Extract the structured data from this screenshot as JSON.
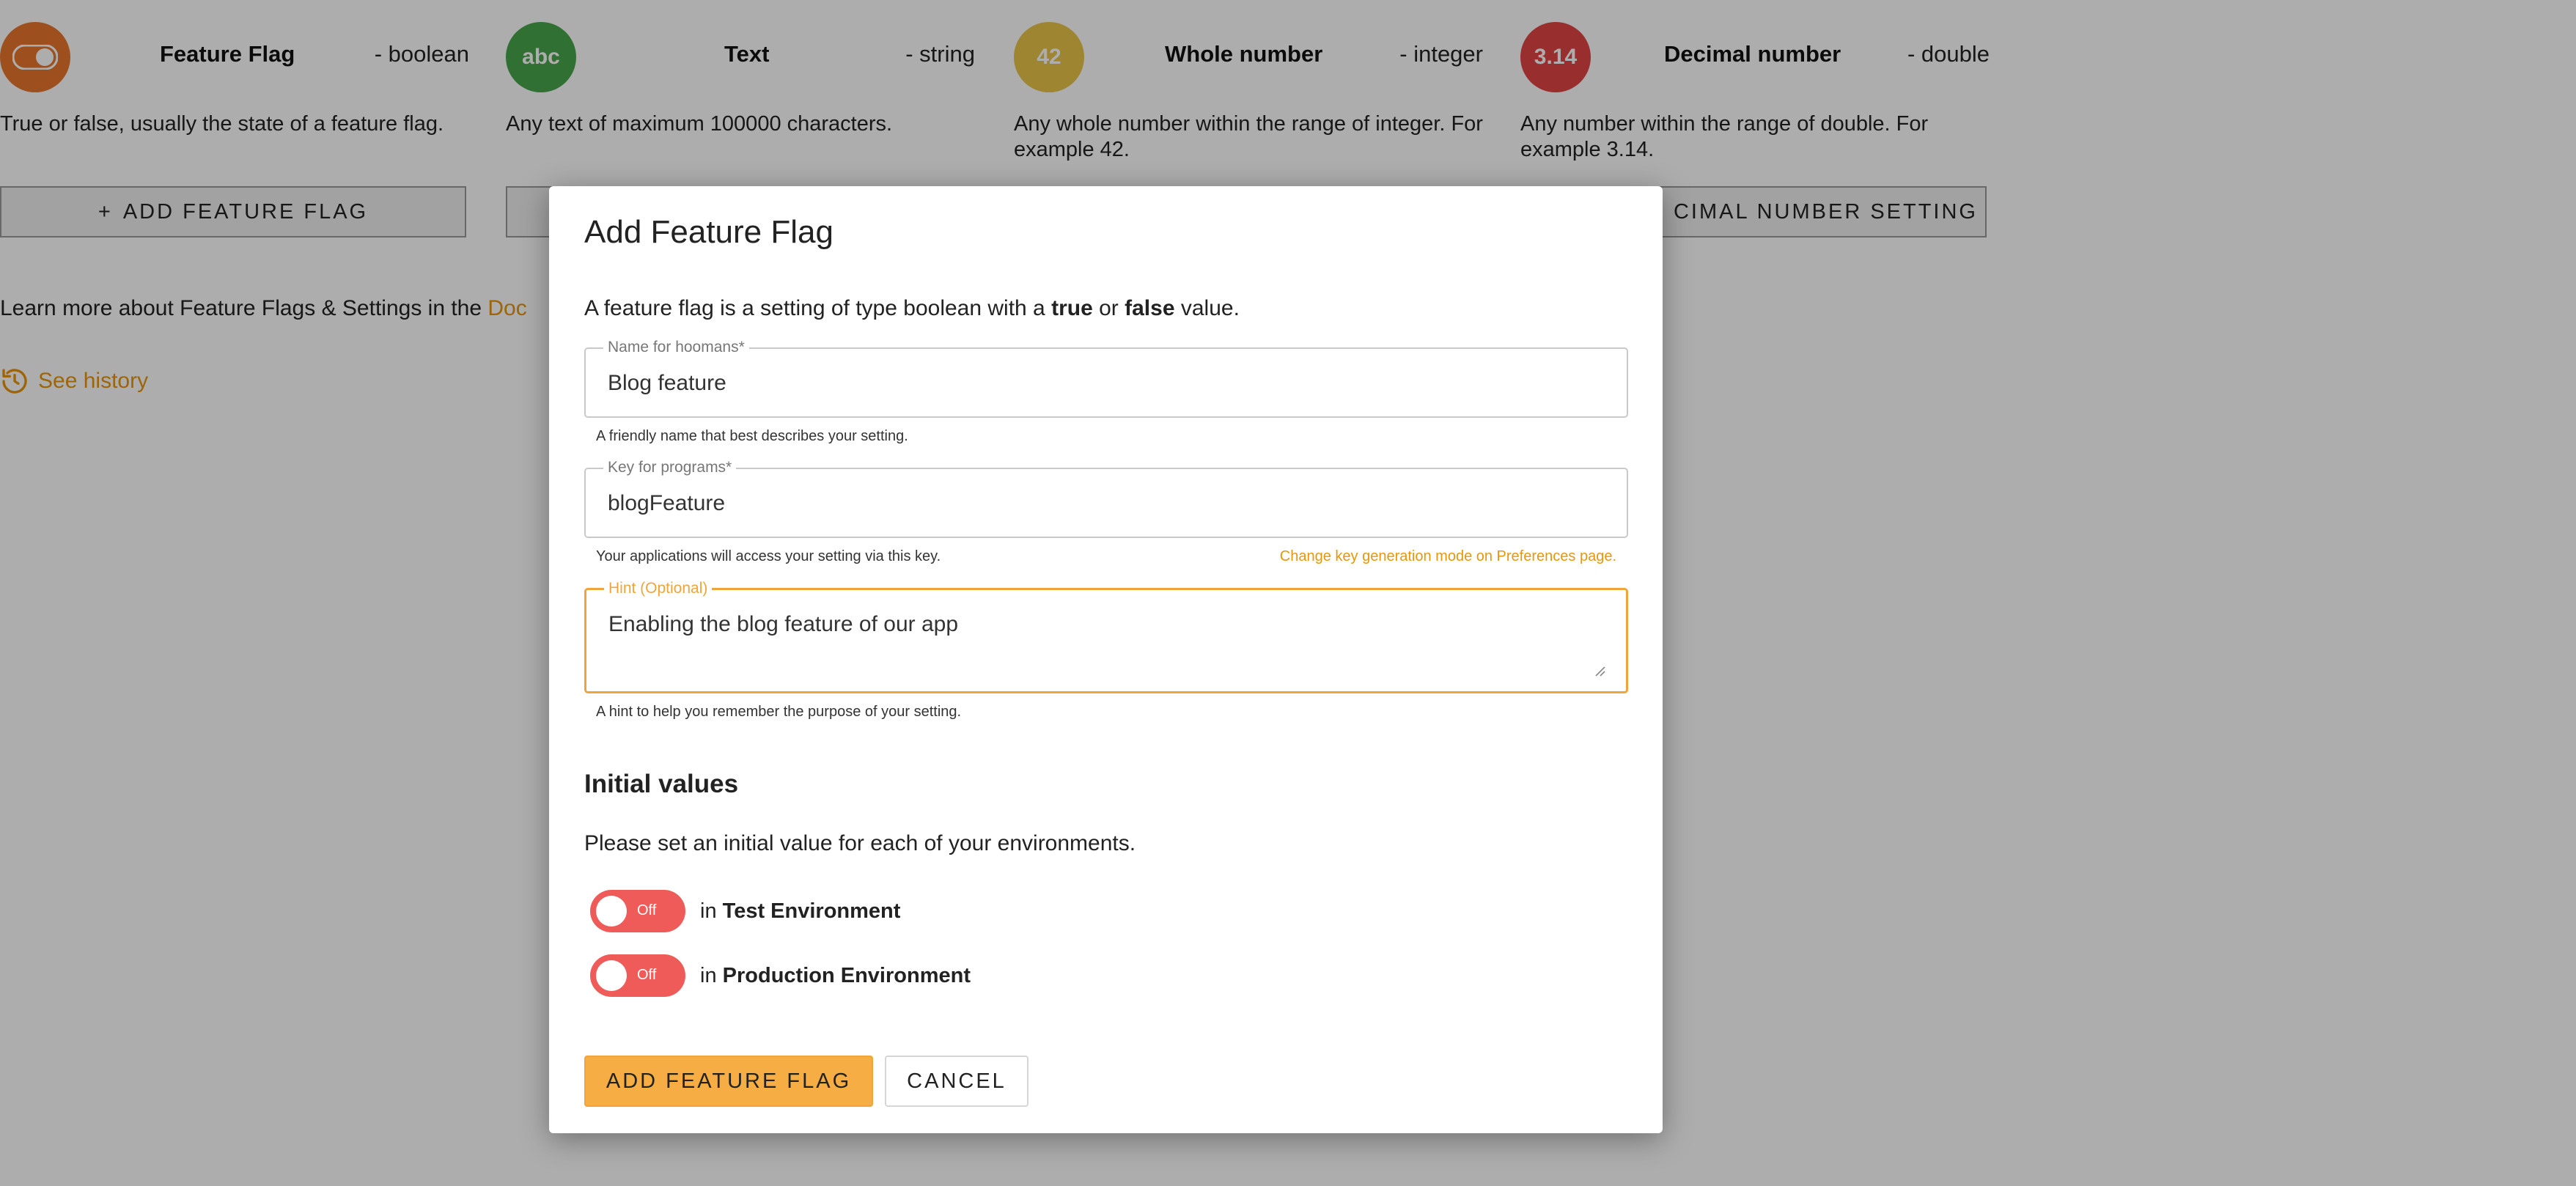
{
  "setting_types": [
    {
      "name": "Feature Flag",
      "kind": "- boolean",
      "icon": "toggle-icon",
      "icon_color": "#e8762b",
      "icon_text": "",
      "description": "True or false, usually the state of a feature flag.",
      "button_label": "ADD FEATURE FLAG"
    },
    {
      "name": "Text",
      "kind": "- string",
      "icon": "abc-icon",
      "icon_color": "#47a54b",
      "icon_text": "abc",
      "description": "Any text of maximum 100000 characters.",
      "button_label": ""
    },
    {
      "name": "Whole number",
      "kind": "- integer",
      "icon": "integer-icon",
      "icon_color": "#e7c44a",
      "icon_text": "42",
      "description": "Any whole number within the range of integer. For example 42.",
      "button_label": ""
    },
    {
      "name": "Decimal number",
      "kind": "- double",
      "icon": "double-icon",
      "icon_color": "#e04545",
      "icon_text": "3.14",
      "description": "Any number within the range of double. For example 3.14.",
      "button_label": "CIMAL NUMBER SETTING"
    }
  ],
  "learn_more": {
    "prefix": "Learn more about Feature Flags & Settings in the ",
    "link": "Doc"
  },
  "see_history": "See history",
  "modal": {
    "title": "Add Feature Flag",
    "intro_prefix": "A feature flag is a setting of type boolean with a ",
    "intro_true": "true",
    "intro_or": " or ",
    "intro_false": "false",
    "intro_suffix": " value.",
    "name_field": {
      "label": "Name for hoomans*",
      "value": "Blog feature",
      "helper": "A friendly name that best describes your setting."
    },
    "key_field": {
      "label": "Key for programs*",
      "value": "blogFeature",
      "helper": "Your applications will access your setting via this key.",
      "link": "Change key generation mode on Preferences page."
    },
    "hint_field": {
      "label": "Hint (Optional)",
      "value": "Enabling the blog feature of our app",
      "helper": "A hint to help you remember the purpose of your setting."
    },
    "initial_values_title": "Initial values",
    "initial_values_desc": "Please set an initial value for each of your environments.",
    "environments": [
      {
        "toggle_text": "Off",
        "prefix": "in ",
        "name": "Test Environment"
      },
      {
        "toggle_text": "Off",
        "prefix": "in ",
        "name": "Production Environment"
      }
    ],
    "submit_label": "ADD FEATURE FLAG",
    "cancel_label": "CANCEL"
  },
  "colors": {
    "accent": "#f0a53a",
    "toggle_off": "#ef5b59",
    "link": "#e8960c"
  }
}
